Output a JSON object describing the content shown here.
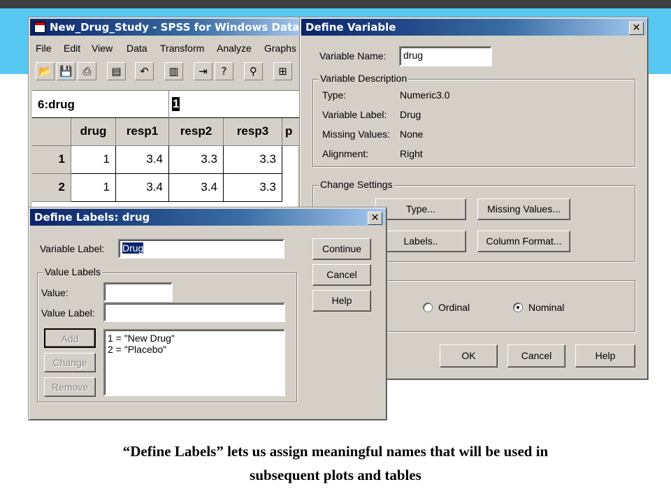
{
  "spss": {
    "title": "New_Drug_Study - SPSS for Windows Data E",
    "menu": [
      "File",
      "Edit",
      "View",
      "Data",
      "Transform",
      "Analyze",
      "Graphs"
    ],
    "cell_ref": "6:drug",
    "cell_value": "1",
    "columns": [
      "drug",
      "resp1",
      "resp2",
      "resp3",
      "p"
    ],
    "rows": [
      {
        "num": "1",
        "cells": [
          "1",
          "3.4",
          "3.3",
          "3.3"
        ]
      },
      {
        "num": "2",
        "cells": [
          "1",
          "3.4",
          "3.4",
          "3.3"
        ]
      }
    ]
  },
  "define_variable": {
    "title": "Define Variable",
    "name_label": "Variable Name:",
    "name_value": "drug",
    "description_group": "Variable Description",
    "type_label": "Type:",
    "type_value": "Numeric3.0",
    "varlabel_label": "Variable Label:",
    "varlabel_value": "Drug",
    "missing_label": "Missing Values:",
    "missing_value": "None",
    "alignment_label": "Alignment:",
    "alignment_value": "Right",
    "change_group": "Change Settings",
    "btn_type": "Type...",
    "btn_missing": "Missing Values...",
    "btn_labels": "Labels..",
    "btn_column_format": "Column Format...",
    "measure_ordinal": "Ordinal",
    "measure_nominal": "Nominal",
    "measure_selected": "Nominal",
    "btn_ok": "OK",
    "btn_cancel": "Cancel",
    "btn_help": "Help"
  },
  "define_labels": {
    "title": "Define Labels: drug",
    "varlabel_label": "Variable Label:",
    "varlabel_value": "Drug",
    "value_labels_group": "Value Labels",
    "value_label": "Value:",
    "value_value": "",
    "value_label_label": "Value Label:",
    "value_label_value": "",
    "btn_add": "Add",
    "btn_change": "Change",
    "btn_remove": "Remove",
    "list": [
      "1 = \"New Drug\"",
      "2 = \"Placebo\""
    ],
    "btn_continue": "Continue",
    "btn_cancel": "Cancel",
    "btn_help": "Help"
  },
  "caption": {
    "line1": "“Define Labels” lets us assign meaningful names that will be used in",
    "line2": "subsequent plots and tables"
  },
  "colors": {
    "title_blue": "#0a246a",
    "dialog_gray": "#d4d0c8",
    "band_cyan": "#57c8f2"
  }
}
